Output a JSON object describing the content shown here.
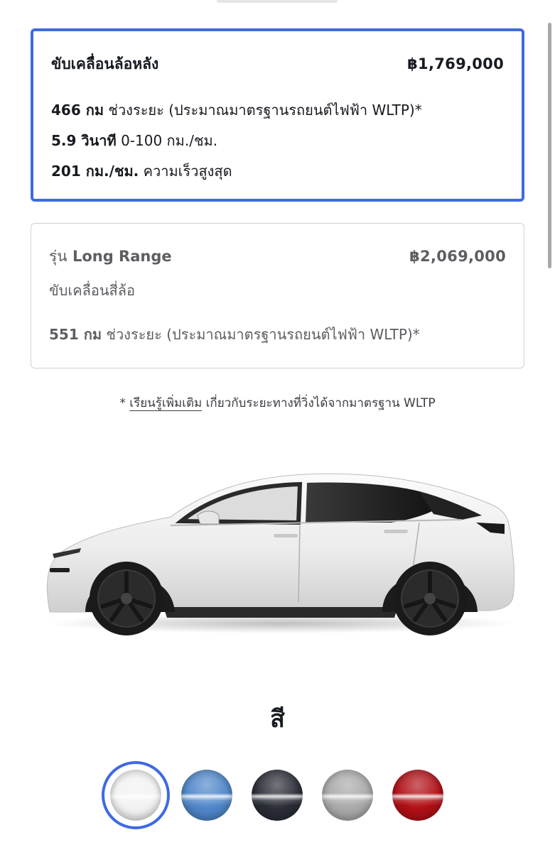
{
  "options": [
    {
      "title": "ขับเคลื่อนล้อหลัง",
      "price": "฿1,769,000",
      "selected": true,
      "specs": [
        {
          "value": "466 กม",
          "label": "ช่วงระยะ (ประมาณมาตรฐานรถยนต์ไฟฟ้า WLTP)*"
        },
        {
          "value": "5.9 วินาที",
          "label": "0-100 กม./ชม."
        },
        {
          "value": "201 กม./ชม.",
          "label": "ความเร็วสูงสุด"
        }
      ]
    },
    {
      "title_prefix": "รุ่น",
      "title": "Long Range",
      "subtitle": "ขับเคลื่อนสี่ล้อ",
      "price": "฿2,069,000",
      "selected": false,
      "specs": [
        {
          "value": "551 กม",
          "label": "ช่วงระยะ (ประมาณมาตรฐานรถยนต์ไฟฟ้า WLTP)*"
        }
      ]
    }
  ],
  "footnote": {
    "asterisk": "*",
    "link_text": "เรียนรู้เพิ่มเติม",
    "rest": "เกี่ยวกับระยะทางที่วิ่งได้จากมาตรฐาน WLTP"
  },
  "color_section": {
    "heading": "สี",
    "swatches": [
      {
        "name": "white",
        "color": "#f2f2f2",
        "selected": true
      },
      {
        "name": "blue",
        "color": "#4f86c8",
        "selected": false
      },
      {
        "name": "black",
        "color": "#2a2d36",
        "selected": false
      },
      {
        "name": "silver",
        "color": "#a9a9a9",
        "selected": false
      },
      {
        "name": "red",
        "color": "#b01016",
        "selected": false
      }
    ]
  },
  "colors": {
    "accent": "#3e6ae1",
    "text_primary": "#171a20",
    "text_secondary": "#5c5e62"
  }
}
